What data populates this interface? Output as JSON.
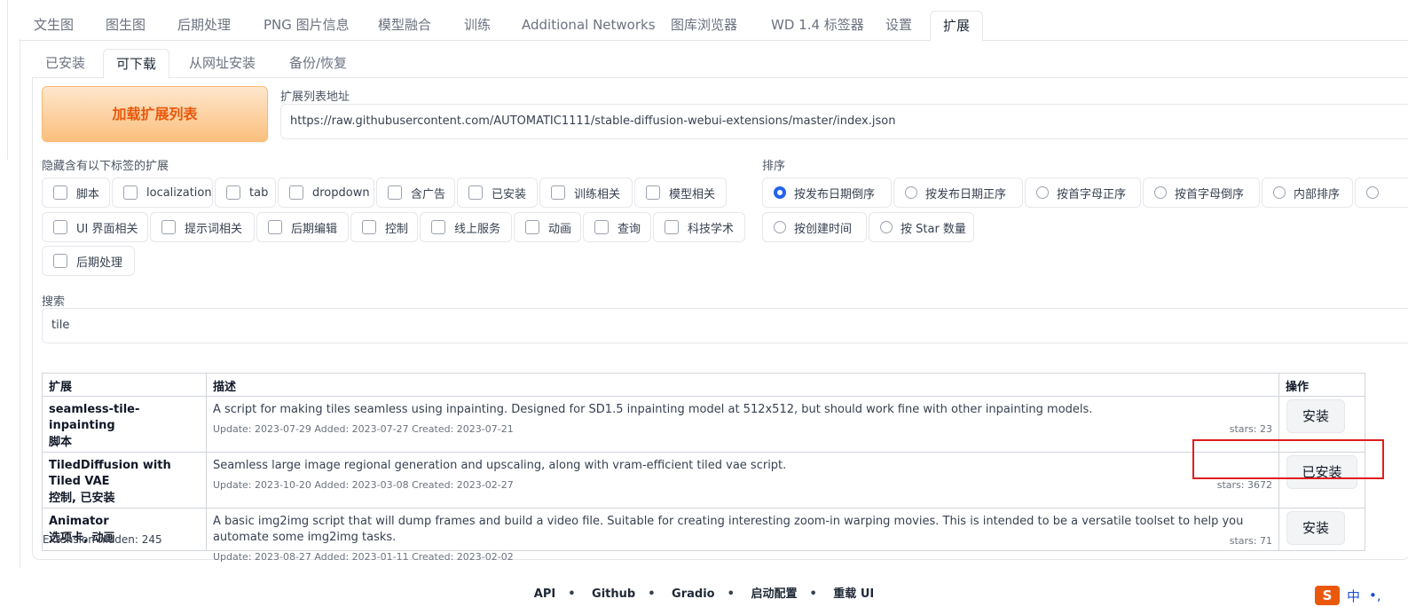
{
  "main_tabs": [
    "文生图",
    "图生图",
    "后期处理",
    "PNG 图片信息",
    "模型融合",
    "训练",
    "Additional Networks",
    "图库浏览器",
    "WD 1.4 标签器",
    "设置",
    "扩展"
  ],
  "sub_tabs": [
    "已安装",
    "可下载",
    "从网址安装",
    "备份/恢复"
  ],
  "load_button": "加载扩展列表",
  "url_label": "扩展列表地址",
  "url_value": "https://raw.githubusercontent.com/AUTOMATIC1111/stable-diffusion-webui-extensions/master/index.json",
  "hide_label": "隐藏含有以下标签的扩展",
  "hide_tags": [
    "脚本",
    "localization",
    "tab",
    "dropdown",
    "含广告",
    "已安装",
    "训练相关",
    "模型相关",
    "UI 界面相关",
    "提示词相关",
    "后期编辑",
    "控制",
    "线上服务",
    "动画",
    "查询",
    "科技学术",
    "后期处理"
  ],
  "sort_label": "排序",
  "sort_options": [
    "按发布日期倒序",
    "按发布日期正序",
    "按首字母正序",
    "按首字母倒序",
    "内部排序",
    "按创建时间",
    "按 Star 数量"
  ],
  "search_label": "搜索",
  "search_value": "tile",
  "table": {
    "headers": [
      "扩展",
      "描述",
      "操作"
    ],
    "rows": [
      {
        "name": "seamless-tile-inpainting",
        "tags": "脚本",
        "desc": "A script for making tiles seamless using inpainting. Designed for SD1.5 inpainting model at 512x512, but should work fine with other inpainting models.",
        "meta": "Update: 2023-07-29 Added: 2023-07-27 Created: 2023-07-21",
        "stars": "stars: 23",
        "action": "安装"
      },
      {
        "name": "TiledDiffusion with Tiled VAE",
        "tags": "控制, 已安装",
        "desc": "Seamless large image regional generation and upscaling, along with vram-efficient tiled vae script.",
        "meta": "Update: 2023-10-20 Added: 2023-03-08 Created: 2023-02-27",
        "stars": "stars: 3672",
        "action": "已安装"
      },
      {
        "name": "Animator",
        "tags": "选项卡, 动画",
        "desc": "A basic img2img script that will dump frames and build a video file. Suitable for creating interesting zoom-in warping movies. This is intended to be a versatile toolset to help you automate some img2img tasks.",
        "meta": "Update: 2023-08-27 Added: 2023-01-11 Created: 2023-02-02",
        "stars": "stars: 71",
        "action": "安装"
      }
    ]
  },
  "hidden_count": "Extension hidden: 245",
  "footer": [
    "API",
    "Github",
    "Gradio",
    "启动配置",
    "重载 UI"
  ],
  "ime": {
    "logo": "S",
    "lang": "中",
    "dots": "•,"
  }
}
